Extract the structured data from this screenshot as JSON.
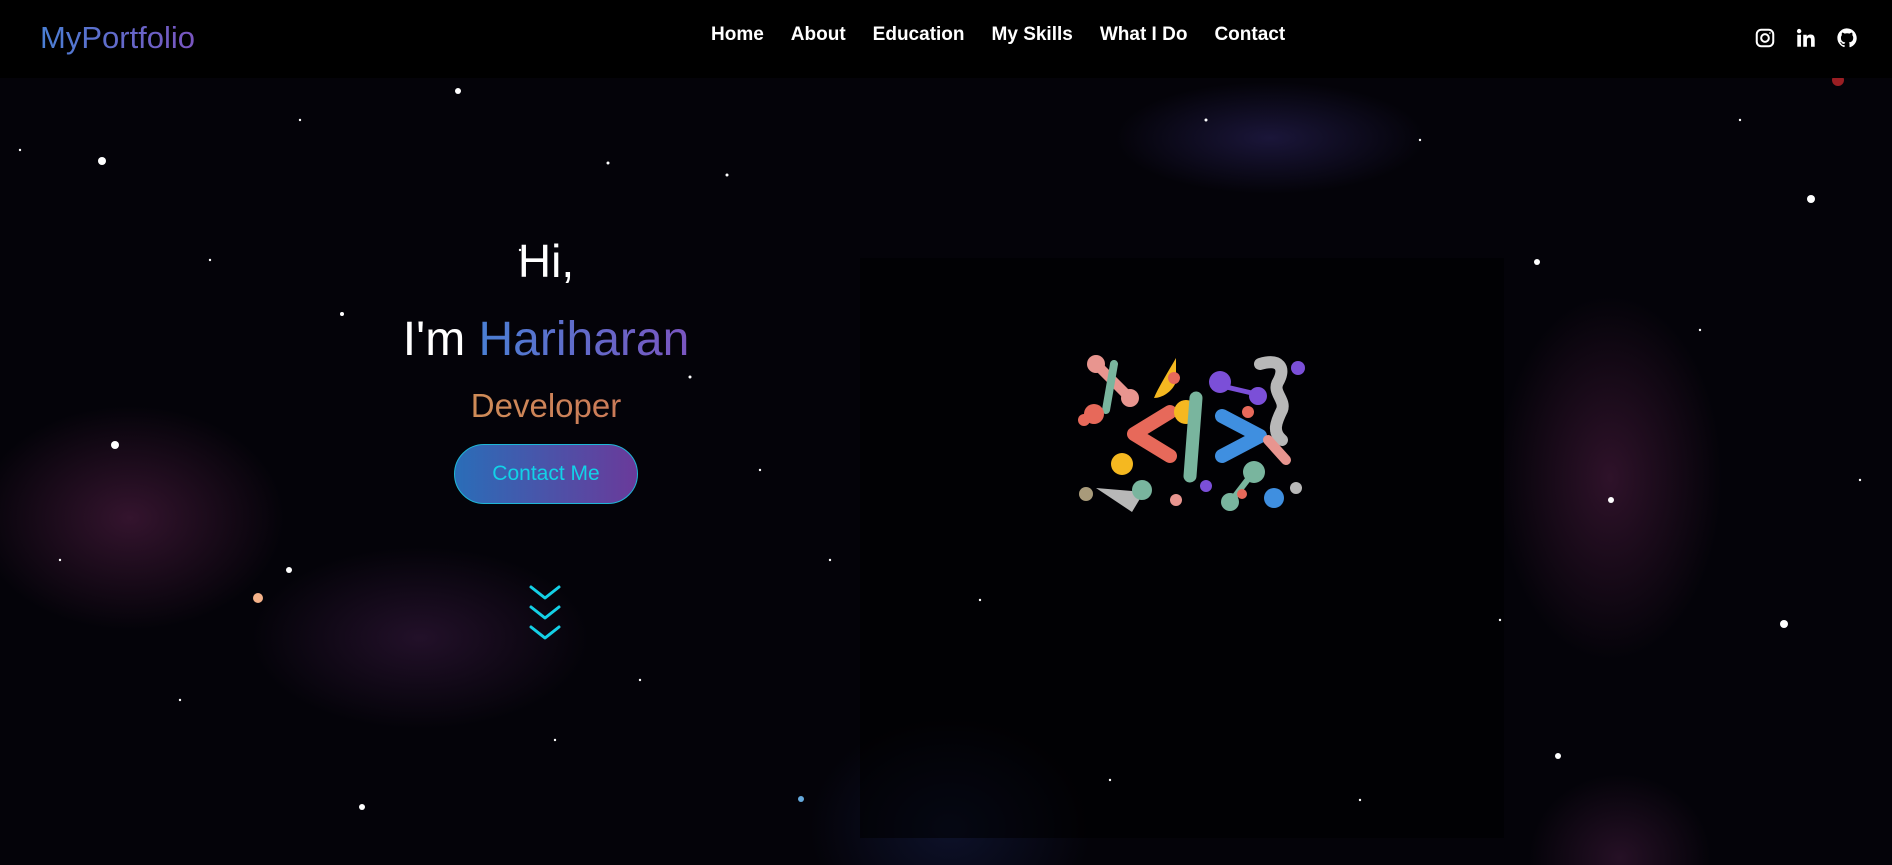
{
  "navbar": {
    "logo": "MyPortfolio",
    "links": [
      "Home",
      "About",
      "Education",
      "My Skills",
      "What I Do",
      "Contact"
    ],
    "socials": [
      "instagram-icon",
      "linkedin-icon",
      "github-icon"
    ]
  },
  "hero": {
    "greeting": "Hi,",
    "intro_prefix": "I'm",
    "name": "Hariharan",
    "role": "Developer",
    "button_label": "Contact Me",
    "scroll_icon": "chevrons-down-icon"
  },
  "illustration": {
    "icon": "code-brackets-illustration"
  },
  "colors": {
    "accent_blue": "#4a7fd4",
    "accent_purple": "#7a55c0",
    "role_gold": "#d39c56",
    "button_text": "#12d2e8",
    "background": "#000000"
  }
}
